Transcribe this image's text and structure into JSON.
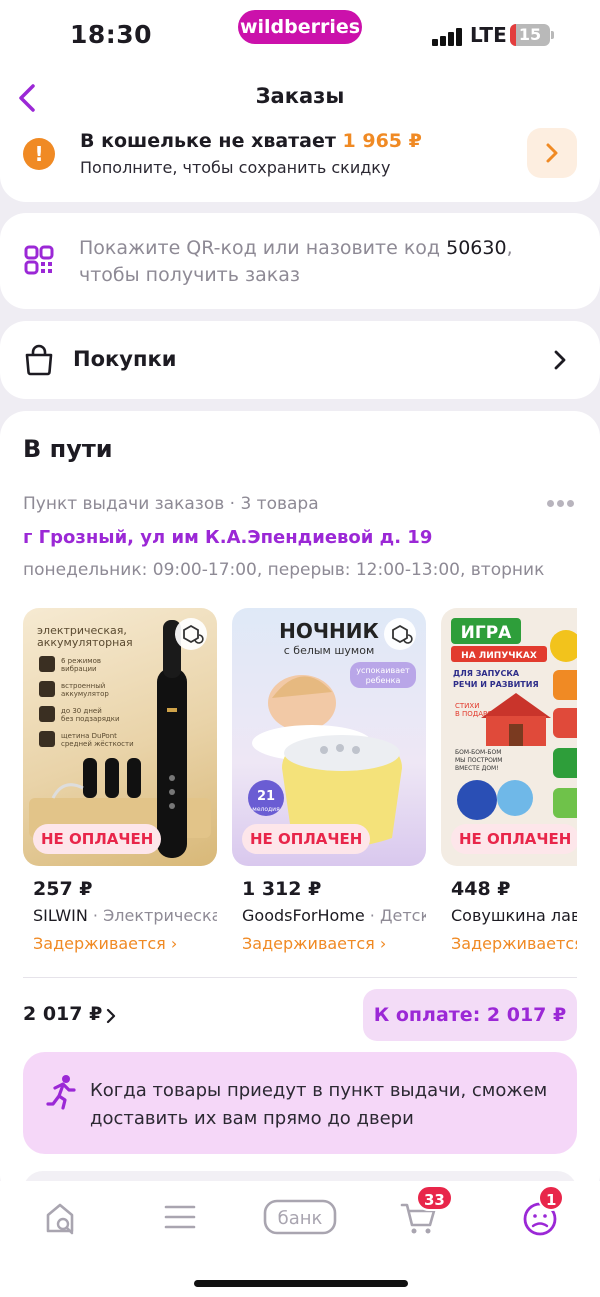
{
  "status_bar": {
    "time": "18:30",
    "brand": "wildberries",
    "network": "LTE",
    "battery": "15",
    "battery_level_percent": 15
  },
  "header": {
    "title": "Заказы",
    "back_icon": "chevron-left-icon"
  },
  "wallet": {
    "message": "В кошельке не хватает",
    "amount": "1 965 ₽",
    "subtitle": "Пополните, чтобы сохранить скидку",
    "warning_icon": "!",
    "accent": "#f08a24"
  },
  "qr": {
    "text_before": "Покажите QR-код или назовите код ",
    "code": "50630",
    "text_after": ", чтобы получить заказ"
  },
  "purchases": {
    "label": "Покупки"
  },
  "transit": {
    "title": "В пути",
    "pickup": "Пункт выдачи заказов · 3 товара",
    "address": "г Грозный, ул им К.А.Эпендиевой д. 19",
    "hours": "понедельник: 09:00-17:00, перерыв: 12:00-13:00, вторник"
  },
  "products": [
    {
      "price": "257 ₽",
      "brand": "SILWIN",
      "name": " · Электрическая щетка",
      "status": "НЕ ОПЛАЧЕН",
      "delay": "Задерживается ›",
      "image_texts": [
        "электрическая,",
        "аккумуляторная",
        "6 режимов",
        "вибрации",
        "встроенный",
        "аккумулятор",
        "до 30 дней",
        "без подзарядки",
        "щетина DuPont",
        "средней жёсткости"
      ]
    },
    {
      "price": "1 312 ₽",
      "brand": "GoodsForHome",
      "name": " · Детский ночник",
      "status": "НЕ ОПЛАЧЕН",
      "delay": "Задерживается ›",
      "image_texts": [
        "НОЧНИК",
        "с белым шумом",
        "успокаивает",
        "ребенка",
        "21",
        "мелодия"
      ]
    },
    {
      "price": "448 ₽",
      "brand": "Совушкина лавка",
      "name": "",
      "status": "НЕ ОПЛАЧЕН",
      "delay": "Задерживается ›",
      "image_texts": [
        "ИГРА",
        "НА ЛИПУЧКАХ",
        "ДЛЯ ЗАПУСКА",
        "РЕЧИ И РАЗВИТИЯ",
        "СТИХИ",
        "В ПОДАРОК",
        "БОМ-БОМ-БОМ",
        "МЫ ПОСТРОИМ",
        "ВМЕСТЕ ДОМ!"
      ]
    }
  ],
  "summary": {
    "total": "2 017 ₽",
    "pay_label": "К оплате: 2 017 ₽"
  },
  "delivery_note": {
    "text": "Когда товары приедут в пункт выдачи, сможем доставить их вам прямо до двери"
  },
  "bottom_nav": {
    "items": [
      {
        "name": "home-search",
        "icon": "home-search-icon"
      },
      {
        "name": "catalog",
        "icon": "menu-icon"
      },
      {
        "name": "bank",
        "icon": "bank-icon",
        "label": "банк"
      },
      {
        "name": "cart",
        "icon": "cart-icon",
        "badge": "33"
      },
      {
        "name": "profile",
        "icon": "profile-icon",
        "badge": "1"
      }
    ]
  },
  "colors": {
    "brand_purple": "#9b28d6",
    "brand_pink": "#cb11ab",
    "warning_orange": "#f08a24",
    "error_red": "#e8264a"
  }
}
